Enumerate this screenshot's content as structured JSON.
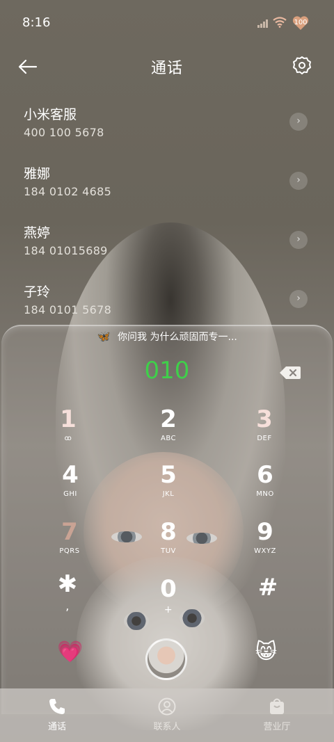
{
  "status": {
    "time": "8:16",
    "battery": "100"
  },
  "header": {
    "title": "通话"
  },
  "contacts": [
    {
      "name": "小米客服",
      "number": "400 100 5678"
    },
    {
      "name": "雅娜",
      "number": "184 0102 4685"
    },
    {
      "name": "燕婷",
      "number": "184 01015689"
    },
    {
      "name": "子玲",
      "number": "184 0101 5678"
    }
  ],
  "dialer": {
    "banner": "你问我 为什么顽固而专一...",
    "number": "010",
    "keys": [
      {
        "digit": "1",
        "sub": "ꝏ"
      },
      {
        "digit": "2",
        "sub": "ABC"
      },
      {
        "digit": "3",
        "sub": "DEF"
      },
      {
        "digit": "4",
        "sub": "GHI"
      },
      {
        "digit": "5",
        "sub": "JKL"
      },
      {
        "digit": "6",
        "sub": "MNO"
      },
      {
        "digit": "7",
        "sub": "PQRS"
      },
      {
        "digit": "8",
        "sub": "TUV"
      },
      {
        "digit": "9",
        "sub": "WXYZ"
      },
      {
        "digit": "✱",
        "sub": ","
      },
      {
        "digit": "0",
        "sub": "+"
      },
      {
        "digit": "#",
        "sub": ""
      }
    ],
    "left_emoji": "💗",
    "right_emoji": "😸"
  },
  "tabs": [
    {
      "label": "通话"
    },
    {
      "label": "联系人"
    },
    {
      "label": "营业厅"
    }
  ],
  "colors": {
    "accent": "#3fd04a"
  }
}
